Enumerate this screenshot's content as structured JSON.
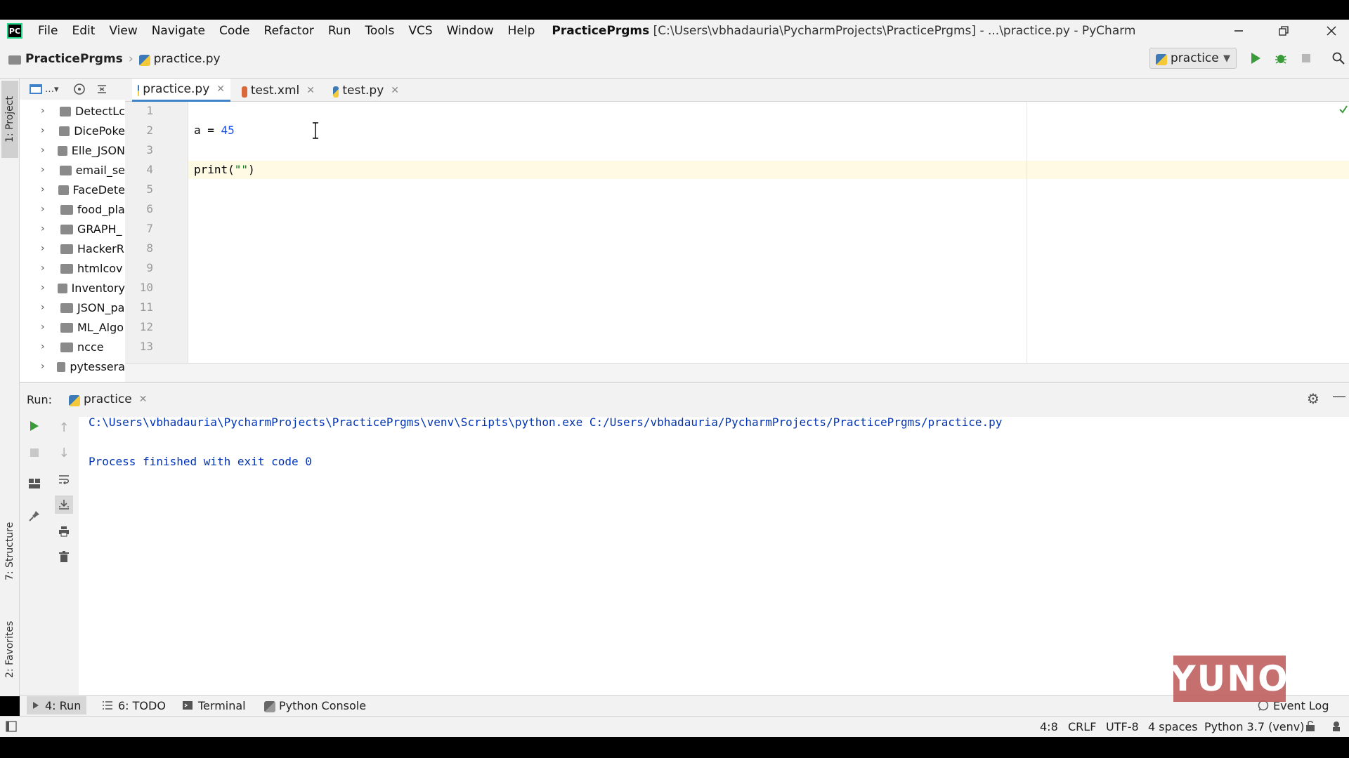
{
  "menubar": {
    "items": [
      "File",
      "Edit",
      "View",
      "Navigate",
      "Code",
      "Refactor",
      "Run",
      "Tools",
      "VCS",
      "Window",
      "Help"
    ],
    "title_project": "PracticePrgms",
    "title_rest": "[C:\\Users\\vbhadauria\\PycharmProjects\\PracticePrgms] - ...\\practice.py - PyCharm"
  },
  "navbar": {
    "project": "PracticePrgms",
    "file": "practice.py",
    "run_config": "practice"
  },
  "sidebar": {
    "project_tab": "1: Project",
    "structure_tab": "7: Structure",
    "favorites_tab": "2: Favorites",
    "items": [
      "DetectLc",
      "DicePoke",
      "Elle_JSON",
      "email_se",
      "FaceDete",
      "food_pla",
      "GRAPH_",
      "HackerR",
      "htmlcov",
      "Inventory",
      "JSON_pa",
      "ML_Algo",
      "ncce",
      "pytessera"
    ]
  },
  "editor": {
    "tabs": [
      "practice.py",
      "test.xml",
      "test.py"
    ],
    "line_numbers": [
      "1",
      "2",
      "3",
      "4",
      "5",
      "6",
      "7",
      "8",
      "9",
      "10",
      "11",
      "12",
      "13"
    ],
    "code": {
      "line2_var": "a = ",
      "line2_num": "45",
      "line4_prefix": "print(",
      "line4_str": "\"\"",
      "line4_suffix": ")"
    }
  },
  "run_panel": {
    "label": "Run:",
    "tab": "practice",
    "console": [
      "C:\\Users\\vbhadauria\\PycharmProjects\\PracticePrgms\\venv\\Scripts\\python.exe C:/Users/vbhadauria/PycharmProjects/PracticePrgms/practice.py",
      "",
      "Process finished with exit code 0"
    ]
  },
  "bottom_tabs": [
    "4: Run",
    "6: TODO",
    "Terminal",
    "Python Console"
  ],
  "event_log": "Event Log",
  "status_bar": {
    "position": "4:8",
    "line_sep": "CRLF",
    "encoding": "UTF-8",
    "indent": "4 spaces",
    "interpreter": "Python 3.7 (venv)"
  },
  "watermark": "YUNO",
  "colors": {
    "accent": "#4083c9",
    "run_green": "#3a9b3a",
    "number": "#1750eb",
    "string": "#067d17",
    "console_text": "#0033b3"
  }
}
